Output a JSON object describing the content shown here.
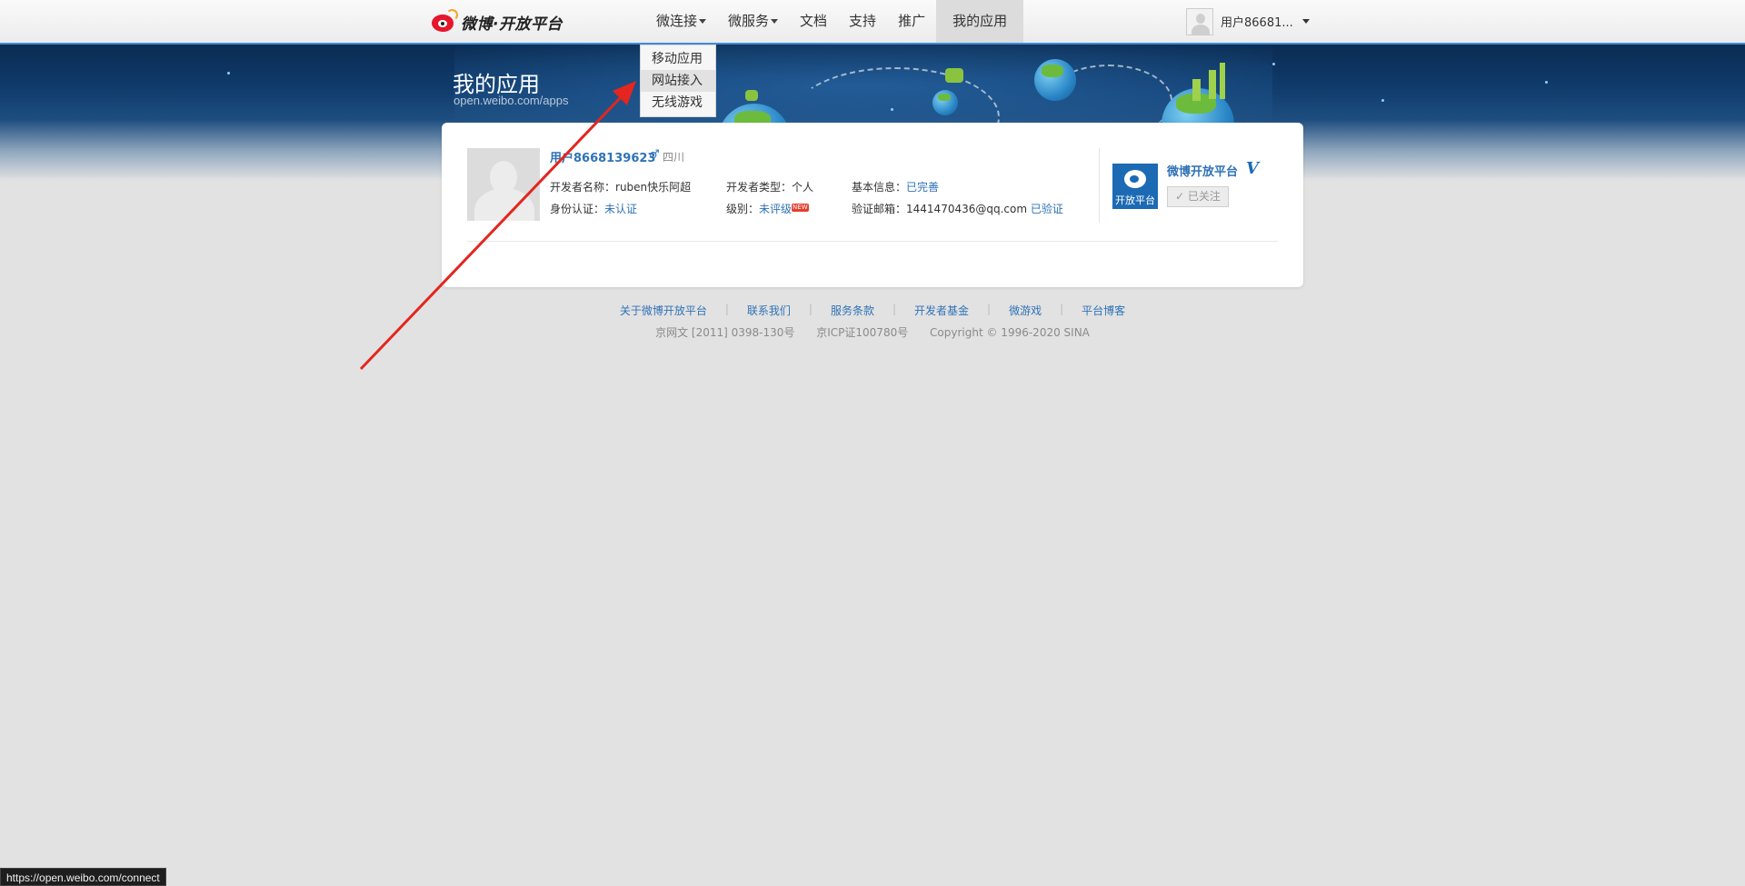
{
  "brand": {
    "logo_text": "微博·开放平台"
  },
  "nav": {
    "items": [
      {
        "label": "微连接",
        "has_caret": true
      },
      {
        "label": "微服务",
        "has_caret": true
      },
      {
        "label": "文档"
      },
      {
        "label": "支持"
      },
      {
        "label": "推广"
      },
      {
        "label": "我的应用",
        "active": true
      }
    ]
  },
  "user": {
    "name": "用户86681..."
  },
  "dropdown": {
    "items": [
      {
        "label": "移动应用"
      },
      {
        "label": "网站接入",
        "hovered": true
      },
      {
        "label": "无线游戏"
      }
    ]
  },
  "banner": {
    "title": "我的应用",
    "subtitle": "open.weibo.com/apps"
  },
  "profile": {
    "username": "用户8668139623",
    "gender_symbol": "♂",
    "region": "四川",
    "developer_name_label": "开发者名称：",
    "developer_name": "ruben快乐阿超",
    "developer_type_label": "开发者类型：",
    "developer_type": "个人",
    "basic_info_label": "基本信息：",
    "basic_info": "已完善",
    "identity_label": "身份认证：",
    "identity": "未认证",
    "level_label": "级别：",
    "level": "未评级",
    "new_badge": "NEW",
    "email_label": "验证邮箱：",
    "email": "1441470436@qq.com",
    "email_status": "已验证"
  },
  "platform": {
    "logo_label": "开放平台",
    "name": "微博开放平台",
    "verified_mark": "V",
    "follow_button": "✓ 已关注"
  },
  "footer": {
    "links": [
      "关于微博开放平台",
      "联系我们",
      "服务条款",
      "开发者基金",
      "微游戏",
      "平台博客"
    ],
    "icp1": "京网文 [2011] 0398-130号",
    "icp2": "京ICP证100780号",
    "copyright": "Copyright © 1996-2020 SINA"
  },
  "status_bar": {
    "url": "https://open.weibo.com/connect"
  },
  "colors": {
    "link": "#2f72b6",
    "accent_border": "#3f8dd6",
    "arrow": "#e3261f"
  }
}
